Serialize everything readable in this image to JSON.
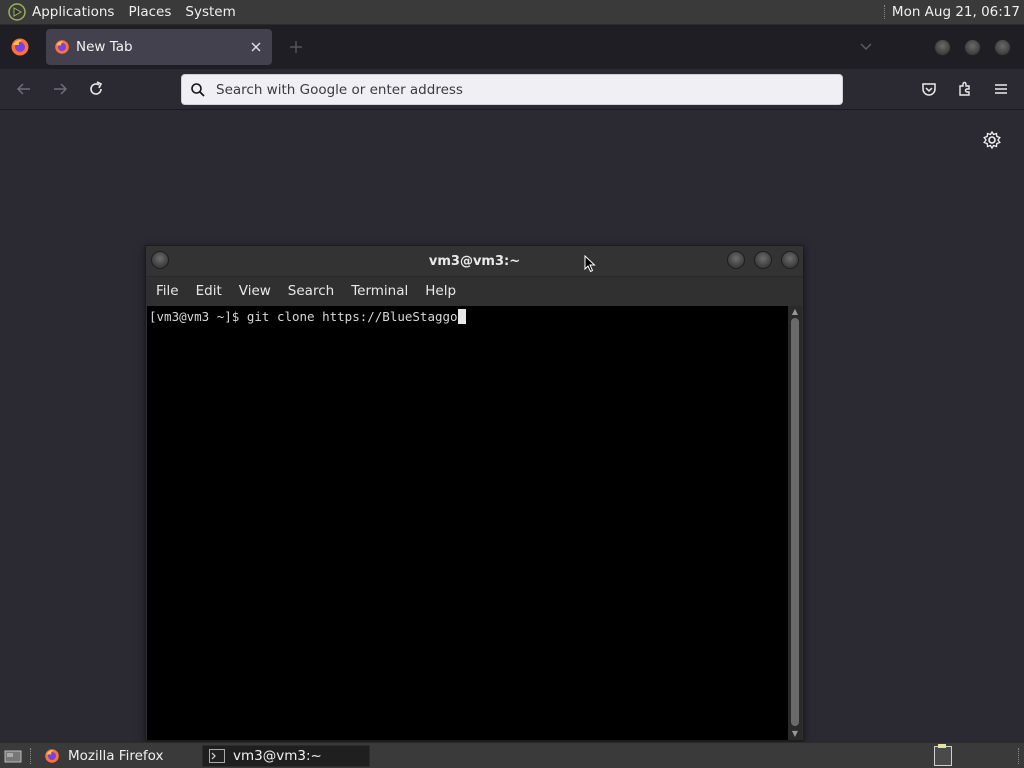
{
  "top_panel": {
    "menus": [
      "Applications",
      "Places",
      "System"
    ],
    "clock": "Mon Aug 21, 06:17"
  },
  "firefox": {
    "tab": {
      "title": "New Tab"
    },
    "url_bar": {
      "placeholder": "Search with Google or enter address",
      "value": ""
    }
  },
  "terminal": {
    "title": "vm3@vm3:~",
    "menus": [
      "File",
      "Edit",
      "View",
      "Search",
      "Terminal",
      "Help"
    ],
    "prompt": "[vm3@vm3 ~]$ ",
    "command": "git clone https://BlueStaggo"
  },
  "taskbar": {
    "items": [
      "Mozilla Firefox",
      "vm3@vm3:~"
    ]
  },
  "colors": {
    "firefox_bg": "#2b2a33",
    "panel_bg": "#3a3a3a",
    "terminal_bg": "#000000"
  }
}
